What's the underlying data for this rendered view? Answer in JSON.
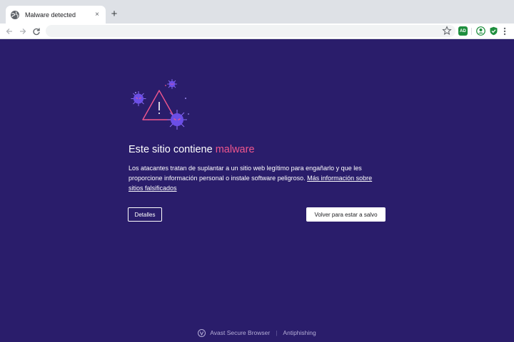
{
  "browser": {
    "tab": {
      "title": "Malware detected",
      "favicon": "globe-icon",
      "close": "×"
    },
    "new_tab": "+",
    "omnibox": {
      "value": "",
      "placeholder": ""
    },
    "extensions": {
      "ad_blocker": {
        "label": "AD",
        "icon": "adblock-icon",
        "color": "#1e8e3e"
      },
      "profile": "profile-icon",
      "shield": "shield-check-icon"
    }
  },
  "colors": {
    "background": "#2a1d6b",
    "accent": "#f0568e",
    "virus": "#6b4ee6"
  },
  "content": {
    "headline_prefix": "Este sitio contiene ",
    "headline_accent": "malware",
    "description": "Los atacantes tratan de suplantar a un sitio web legítimo para engañarlo y que les proporcione información personal o instale software peligroso. ",
    "learn_more": "Más información sobre sitios falsificados",
    "details_button": "Detalles",
    "back_button": "Volver para estar a salvo"
  },
  "footer": {
    "brand": "Avast Secure Browser",
    "separator": "|",
    "feature": "Antiphishing"
  }
}
